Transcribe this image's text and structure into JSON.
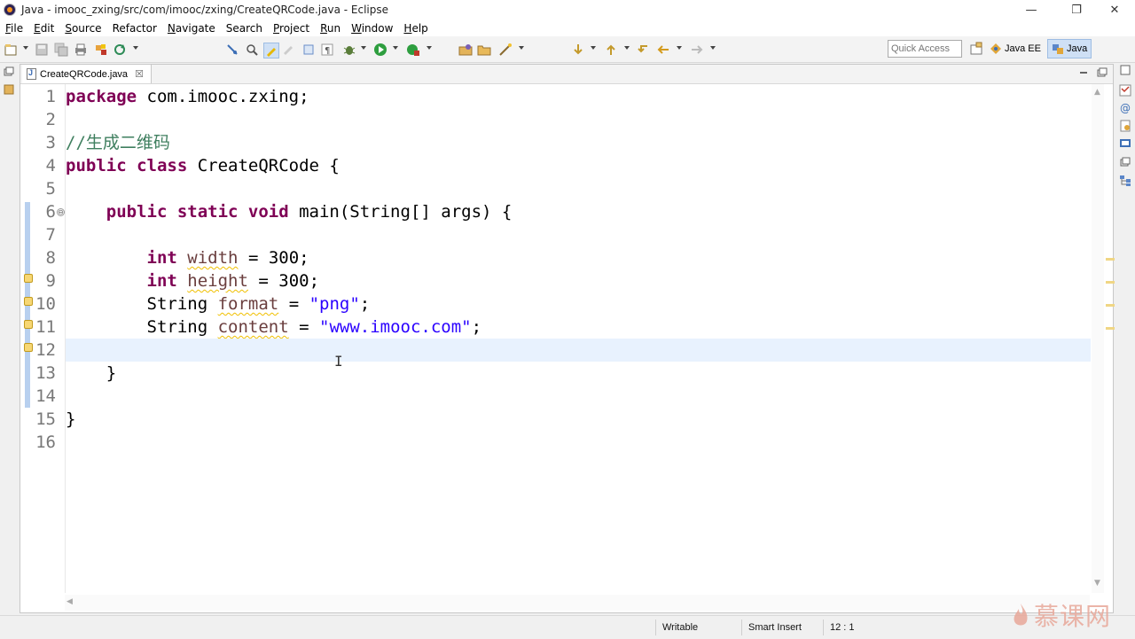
{
  "window": {
    "title": "Java - imooc_zxing/src/com/imooc/zxing/CreateQRCode.java - Eclipse",
    "minimize_glyph": "—",
    "restore_glyph": "❐",
    "close_glyph": "✕"
  },
  "menu": {
    "items": [
      {
        "label": "File",
        "mnemonic": "F",
        "rest": "ile"
      },
      {
        "label": "Edit",
        "mnemonic": "E",
        "rest": "dit"
      },
      {
        "label": "Source",
        "mnemonic": "S",
        "rest": "ource"
      },
      {
        "label": "Refactor",
        "mnemonic": "",
        "rest": "Refactor"
      },
      {
        "label": "Navigate",
        "mnemonic": "N",
        "rest": "avigate"
      },
      {
        "label": "Search",
        "mnemonic": "",
        "rest": "Search"
      },
      {
        "label": "Project",
        "mnemonic": "P",
        "rest": "roject"
      },
      {
        "label": "Run",
        "mnemonic": "R",
        "rest": "un"
      },
      {
        "label": "Window",
        "mnemonic": "W",
        "rest": "indow"
      },
      {
        "label": "Help",
        "mnemonic": "H",
        "rest": "elp"
      }
    ]
  },
  "toolbar": {
    "quick_access_placeholder": "Quick Access",
    "perspectives": [
      {
        "label": "Java EE",
        "active": false
      },
      {
        "label": "Java",
        "active": true
      }
    ]
  },
  "editor": {
    "tab_label": "CreateQRCode.java",
    "tab_close_glyph": "☒",
    "lines": [
      {
        "num": "1"
      },
      {
        "num": "2"
      },
      {
        "num": "3"
      },
      {
        "num": "4"
      },
      {
        "num": "5"
      },
      {
        "num": "6"
      },
      {
        "num": "7"
      },
      {
        "num": "8"
      },
      {
        "num": "9"
      },
      {
        "num": "10"
      },
      {
        "num": "11"
      },
      {
        "num": "12"
      },
      {
        "num": "13"
      },
      {
        "num": "14"
      },
      {
        "num": "15"
      },
      {
        "num": "16"
      }
    ],
    "code": {
      "l1_kw": "package",
      "l1_rest": " com.imooc.zxing;",
      "l3_comment": "//生成二维码",
      "l4_kw": "public class",
      "l4_rest": " CreateQRCode {",
      "l6_kw": "public static void",
      "l6_rest": " main(String[] args) {",
      "l8_kw": "int",
      "l8_var": "width",
      "l8_rest": " = 300;",
      "l9_kw": "int",
      "l9_var": "height",
      "l9_rest": " = 300;",
      "l10_type": "String",
      "l10_var": "format",
      "l10_eq": " = ",
      "l10_str": "\"png\"",
      "l10_end": ";",
      "l11_type": "String",
      "l11_var": "content",
      "l11_eq": " = ",
      "l11_str": "\"www.imooc.com\"",
      "l11_end": ";",
      "l13_brace": "}",
      "l15_brace": "}"
    },
    "current_line": 12
  },
  "status": {
    "writable": "Writable",
    "insert_mode": "Smart Insert",
    "position": "12 : 1"
  },
  "watermark": {
    "text": "慕课网"
  },
  "colors": {
    "keyword": "#7f0055",
    "comment": "#3f7f5f",
    "string": "#2a00ff",
    "current_line": "#e8f2fe"
  }
}
